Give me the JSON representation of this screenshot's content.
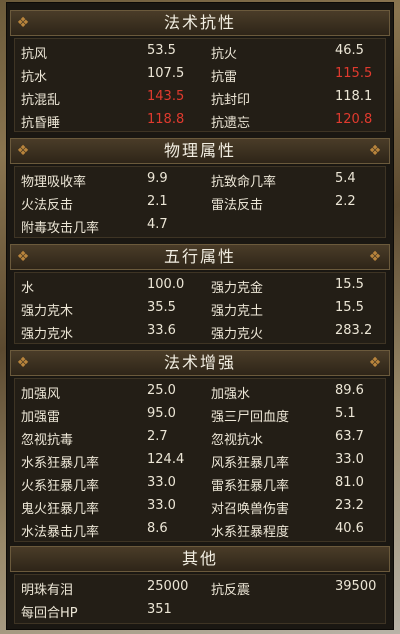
{
  "sections": {
    "magic_resist": {
      "title": "法术抗性",
      "rows": [
        {
          "l1": "抗风",
          "v1": "53.5",
          "l2": "抗火",
          "v2": "46.5"
        },
        {
          "l1": "抗水",
          "v1": "107.5",
          "l2": "抗雷",
          "v2": "115.5"
        },
        {
          "l1": "抗混乱",
          "v1": "143.5",
          "l2": "抗封印",
          "v2": "118.1"
        },
        {
          "l1": "抗昏睡",
          "v1": "118.8",
          "l2": "抗遗忘",
          "v2": "120.8"
        }
      ]
    },
    "physical": {
      "title": "物理属性",
      "rows": [
        {
          "l1": "物理吸收率",
          "v1": "9.9",
          "l2": "抗致命几率",
          "v2": "5.4"
        },
        {
          "l1": "火法反击",
          "v1": "2.1",
          "l2": "雷法反击",
          "v2": "2.2"
        },
        {
          "l1": "附毒攻击几率",
          "v1": "4.7",
          "l2": "",
          "v2": ""
        }
      ]
    },
    "five_elements": {
      "title": "五行属性",
      "rows": [
        {
          "l1": "水",
          "v1": "100.0",
          "l2": "强力克金",
          "v2": "15.5"
        },
        {
          "l1": "强力克木",
          "v1": "35.5",
          "l2": "强力克土",
          "v2": "15.5"
        },
        {
          "l1": "强力克水",
          "v1": "33.6",
          "l2": "强力克火",
          "v2": "283.2"
        }
      ]
    },
    "magic_boost": {
      "title": "法术增强",
      "rows": [
        {
          "l1": "加强风",
          "v1": "25.0",
          "l2": "加强水",
          "v2": "89.6"
        },
        {
          "l1": "加强雷",
          "v1": "95.0",
          "l2": "强三尸回血度",
          "v2": "5.1"
        },
        {
          "l1": "忽视抗毒",
          "v1": "2.7",
          "l2": "忽视抗水",
          "v2": "63.7"
        },
        {
          "l1": "水系狂暴几率",
          "v1": "124.4",
          "l2": "风系狂暴几率",
          "v2": "33.0"
        },
        {
          "l1": "火系狂暴几率",
          "v1": "33.0",
          "l2": "雷系狂暴几率",
          "v2": "81.0"
        },
        {
          "l1": "鬼火狂暴几率",
          "v1": "33.0",
          "l2": "对召唤兽伤害",
          "v2": "23.2"
        },
        {
          "l1": "水法暴击几率",
          "v1": "8.6",
          "l2": "水系狂暴程度",
          "v2": "40.6"
        }
      ]
    },
    "other": {
      "title": "其他",
      "rows": [
        {
          "l1": "明珠有泪",
          "v1": "25000",
          "l2": "抗反震",
          "v2": "39500"
        },
        {
          "l1": "每回合HP",
          "v1": "351",
          "l2": "",
          "v2": ""
        }
      ]
    }
  },
  "buttons": {
    "refresh": "C",
    "close": "✕"
  },
  "colors": {
    "highlight": "#e03a2e",
    "text": "#ece6d6"
  }
}
